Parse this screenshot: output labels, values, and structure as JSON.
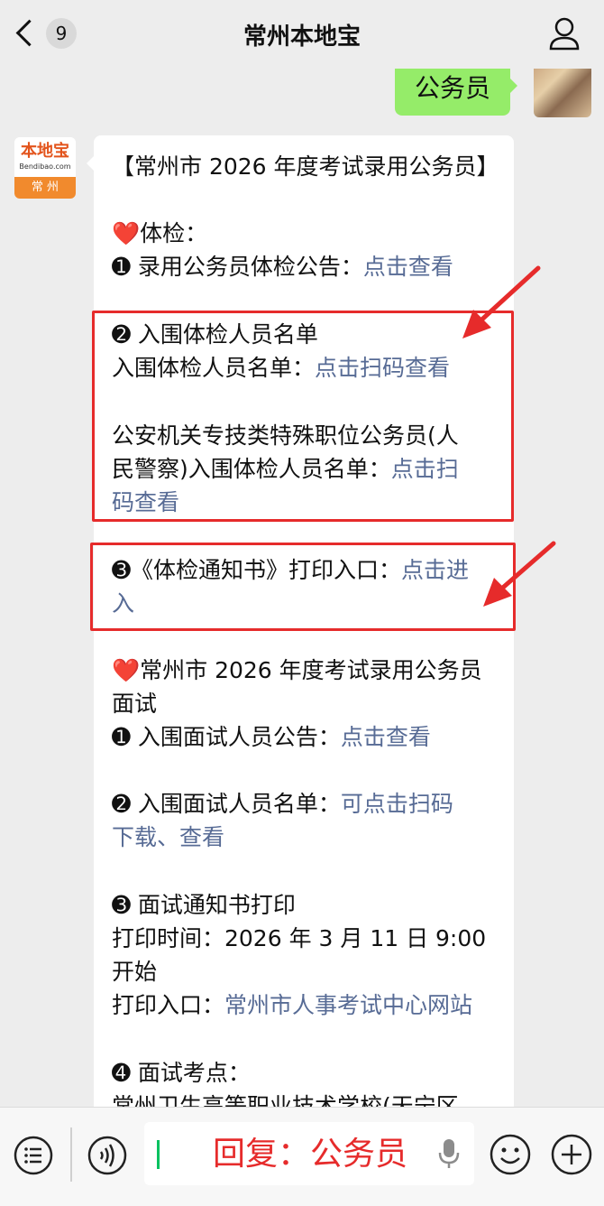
{
  "header": {
    "title": "常州本地宝",
    "unread_count": "9",
    "back_icon": "chevron-left-icon",
    "profile_icon": "person-icon"
  },
  "outgoing_message": {
    "text": "公务员"
  },
  "bot": {
    "avatar": {
      "logo_main": "本地宝",
      "logo_sub": "Bendibao.com",
      "city": "常 州"
    },
    "lines": [
      {
        "text": "【常州市 2026 年度考试录用公务员】",
        "link": ""
      },
      {
        "text": "❤️体检：",
        "link": ""
      },
      {
        "text": "➊ 录用公务员体检公告：",
        "link": "点击查看"
      },
      {
        "text": "➋ 入围体检人员名单",
        "link": ""
      },
      {
        "text": "入围体检人员名单：",
        "link": "点击扫码查看"
      },
      {
        "text": "公安机关专技类特殊职位公务员(人",
        "link": ""
      },
      {
        "text": "民警察)入围体检人员名单：",
        "link": "点击扫"
      },
      {
        "text": "",
        "link": "码查看"
      },
      {
        "text": "➌《体检通知书》打印入口：",
        "link": "点击进"
      },
      {
        "text": "",
        "link": "入"
      },
      {
        "text": "❤️常州市 2026 年度考试录用公务员",
        "link": ""
      },
      {
        "text": "面试",
        "link": ""
      },
      {
        "text": "➊ 入围面试人员公告：",
        "link": "点击查看"
      },
      {
        "text": "➋ 入围面试人员名单：",
        "link": "可点击扫码"
      },
      {
        "text": "",
        "link": "下载、查看"
      },
      {
        "text": "➌ 面试通知书打印",
        "link": ""
      },
      {
        "text": "打印时间：2026 年 3 月 11 日 9:00",
        "link": ""
      },
      {
        "text": "开始",
        "link": ""
      },
      {
        "text": "打印入口：",
        "link": "常州市人事考试中心网站"
      },
      {
        "text": "➍ 面试考点：",
        "link": ""
      },
      {
        "text": "常州卫生高等职业技术学校(天宁区",
        "link": ""
      }
    ]
  },
  "input_bar": {
    "menu_icon": "list-menu-icon",
    "voice_icon": "voice-icon",
    "input_value": "回复：公务员",
    "mic_icon": "microphone-icon",
    "emoji_icon": "emoji-icon",
    "plus_icon": "plus-icon"
  },
  "colors": {
    "link": "#576b95",
    "bubble_green": "#95ec69",
    "highlight_red": "#e62b2b",
    "background": "#ededed"
  }
}
